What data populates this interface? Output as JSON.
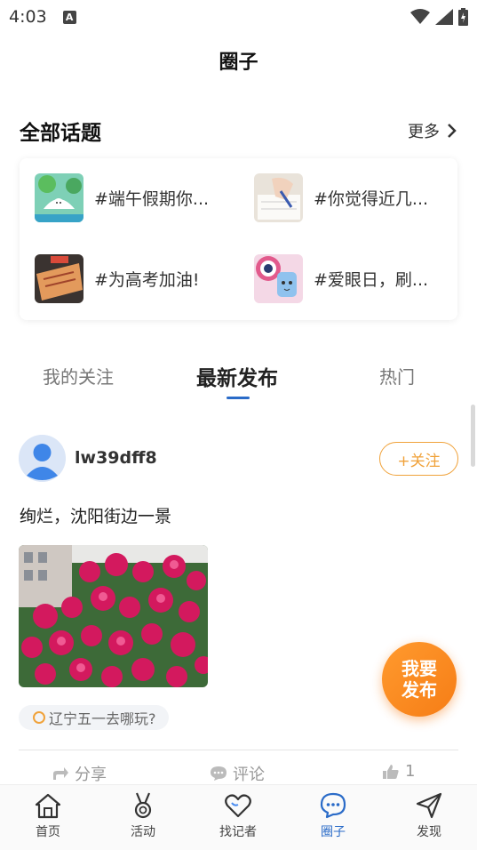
{
  "status": {
    "time": "4:03",
    "a_badge": "A"
  },
  "header": {
    "title": "圈子"
  },
  "topics_section": {
    "title": "全部话题",
    "more_label": "更多",
    "topics": [
      {
        "label": "#端午假期你...",
        "icon": "dragon-boat-thumbnail"
      },
      {
        "label": "#你觉得近几...",
        "icon": "writing-hand-thumbnail"
      },
      {
        "label": "#为高考加油!",
        "icon": "exam-paper-thumbnail"
      },
      {
        "label": "#爱眼日，刷...",
        "icon": "eye-cartoon-thumbnail"
      }
    ]
  },
  "tabs": [
    {
      "label": "我的关注",
      "active": false
    },
    {
      "label": "最新发布",
      "active": true
    },
    {
      "label": "热门",
      "active": false
    }
  ],
  "post": {
    "username": "lw39dff8",
    "follow_label": "+关注",
    "text": "绚烂，沈阳街边一景",
    "image": "pink-roses-photo",
    "topic_tag": "辽宁五一去哪玩?",
    "share_label": "分享",
    "comment_label": "评论",
    "like_count": "1"
  },
  "fab": {
    "line1": "我要",
    "line2": "发布"
  },
  "bottom_nav": [
    {
      "label": "首页",
      "icon": "home-icon",
      "active": false
    },
    {
      "label": "活动",
      "icon": "medal-icon",
      "active": false
    },
    {
      "label": "找记者",
      "icon": "heart-icon",
      "active": false
    },
    {
      "label": "圈子",
      "icon": "chat-bubble-icon",
      "active": true
    },
    {
      "label": "发现",
      "icon": "send-icon",
      "active": false
    }
  ],
  "colors": {
    "accent": "#2a6bc8",
    "orange": "#f0a23a",
    "fab": "#f67d16"
  }
}
